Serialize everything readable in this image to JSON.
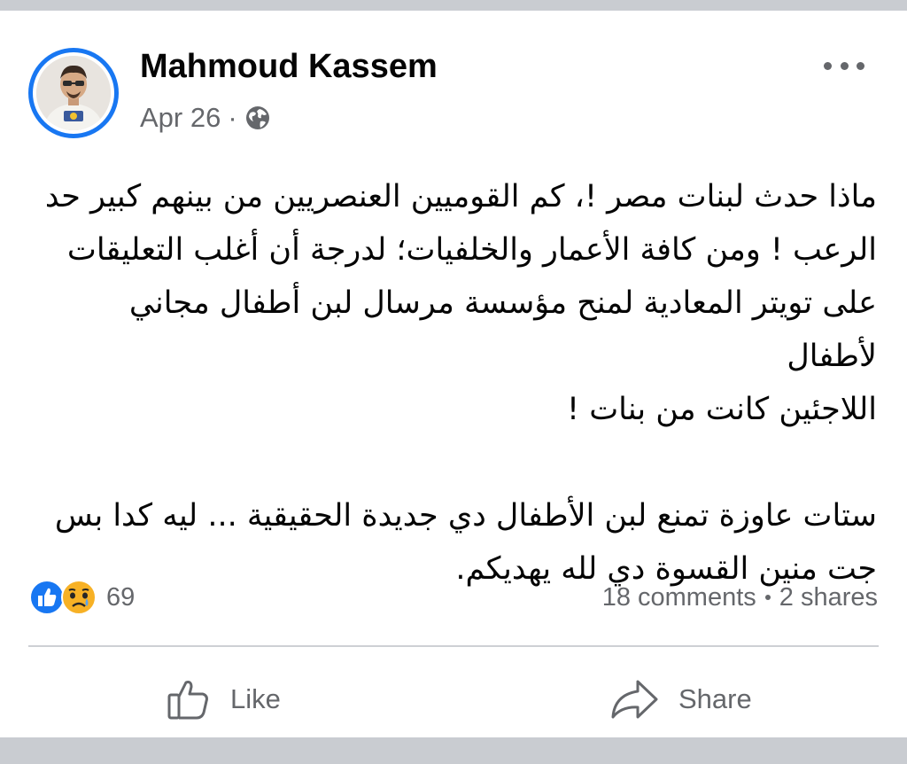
{
  "post": {
    "author": "Mahmoud Kassem",
    "date": "Apr 26",
    "separator": "·",
    "privacy_icon": "globe-icon",
    "paragraphs": [
      "ماذا حدث لبنات مصر !، كم القوميين العنصريين من بينهم كبير حد\nالرعب ! ومن كافة الأعمار والخلفيات؛ لدرجة أن أغلب التعليقات\nعلى تويتر المعادية لمنح مؤسسة مرسال لبن أطفال مجاني لأطفال\nاللاجئين كانت من بنات !",
      "ستات عاوزة تمنع لبن الأطفال دي جديدة الحقيقية ... ليه كدا بس\nجت منين القسوة دي لله يهديكم."
    ]
  },
  "reactions": {
    "icons": [
      "like-icon",
      "sad-icon"
    ],
    "count": "69"
  },
  "stats": {
    "comments": "18 comments",
    "shares": "2 shares"
  },
  "actions": {
    "like_label": "Like",
    "share_label": "Share"
  },
  "colors": {
    "accent": "#1877f2",
    "text": "#050505",
    "secondary_text": "#65676b",
    "sad_face": "#f7b125"
  }
}
